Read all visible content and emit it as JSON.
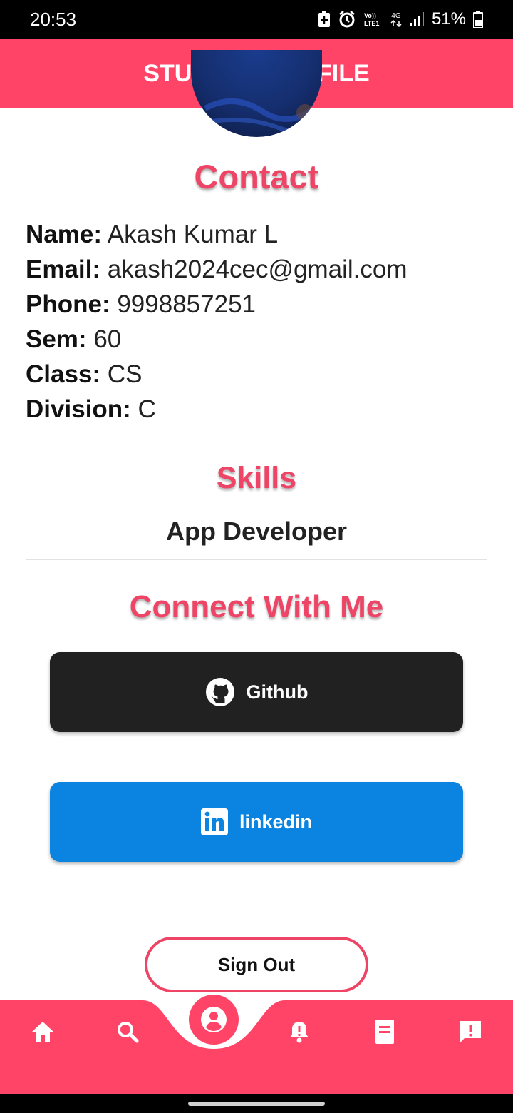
{
  "status_bar": {
    "time": "20:53",
    "network": "4G",
    "battery": "51%",
    "icons": [
      "battery-saver-icon",
      "alarm-icon",
      "volte-icon",
      "data-arrows-icon",
      "signal-icon",
      "battery-icon"
    ]
  },
  "app_bar": {
    "title": "STUDENT PROFILE"
  },
  "contact": {
    "title": "Contact",
    "fields": [
      {
        "label": "Name:",
        "value": "Akash Kumar L"
      },
      {
        "label": "Email:",
        "value": "akash2024cec@gmail.com"
      },
      {
        "label": "Phone:",
        "value": "9998857251"
      },
      {
        "label": "Sem:",
        "value": "60"
      },
      {
        "label": "Class:",
        "value": "CS"
      },
      {
        "label": "Division:",
        "value": "C"
      }
    ]
  },
  "skills": {
    "title": "Skills",
    "value": "App Developer"
  },
  "connect": {
    "title": "Connect With Me",
    "github": {
      "label": "Github",
      "icon": "github-icon",
      "color": "#212121"
    },
    "linkedin": {
      "label": "linkedin",
      "icon": "linkedin-icon",
      "color": "#0a84e0"
    }
  },
  "sign_out": {
    "label": "Sign Out"
  },
  "bottom_nav": {
    "items": [
      "home-icon",
      "search-icon",
      "profile-icon",
      "notification-icon",
      "document-icon",
      "feedback-icon"
    ],
    "active": "profile-icon"
  },
  "colors": {
    "accent": "#ff4468",
    "title": "#ee4466"
  }
}
